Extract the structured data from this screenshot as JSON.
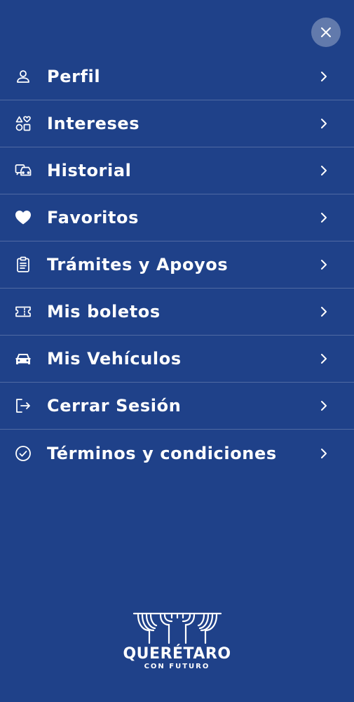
{
  "menu": {
    "items": [
      {
        "label": "Perfil",
        "icon": "user-icon"
      },
      {
        "label": "Intereses",
        "icon": "shapes-icon"
      },
      {
        "label": "Historial",
        "icon": "vehicles-icon"
      },
      {
        "label": "Favoritos",
        "icon": "heart-icon"
      },
      {
        "label": "Trámites y Apoyos",
        "icon": "clipboard-icon"
      },
      {
        "label": "Mis boletos",
        "icon": "ticket-icon"
      },
      {
        "label": "Mis Vehículos",
        "icon": "car-icon"
      },
      {
        "label": "Cerrar Sesión",
        "icon": "logout-icon"
      },
      {
        "label": "Términos y condiciones",
        "icon": "check-circle-icon"
      }
    ]
  },
  "logo": {
    "title": "QUERÉTARO",
    "subtitle": "CON FUTURO"
  },
  "colors": {
    "background": "#1f4189",
    "foreground": "#ffffff",
    "divider": "rgba(255,255,255,0.22)",
    "close_button_bg": "rgba(255,255,255,0.30)"
  }
}
